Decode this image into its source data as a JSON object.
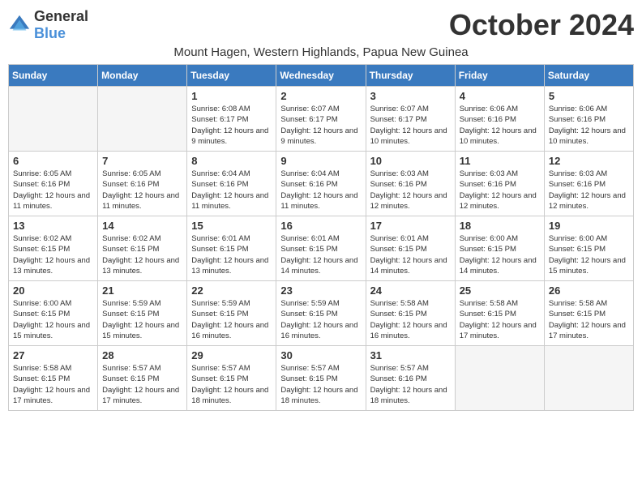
{
  "logo": {
    "general": "General",
    "blue": "Blue"
  },
  "header": {
    "month": "October 2024",
    "location": "Mount Hagen, Western Highlands, Papua New Guinea"
  },
  "weekdays": [
    "Sunday",
    "Monday",
    "Tuesday",
    "Wednesday",
    "Thursday",
    "Friday",
    "Saturday"
  ],
  "weeks": [
    [
      {
        "day": "",
        "info": ""
      },
      {
        "day": "",
        "info": ""
      },
      {
        "day": "1",
        "info": "Sunrise: 6:08 AM\nSunset: 6:17 PM\nDaylight: 12 hours and 9 minutes."
      },
      {
        "day": "2",
        "info": "Sunrise: 6:07 AM\nSunset: 6:17 PM\nDaylight: 12 hours and 9 minutes."
      },
      {
        "day": "3",
        "info": "Sunrise: 6:07 AM\nSunset: 6:17 PM\nDaylight: 12 hours and 10 minutes."
      },
      {
        "day": "4",
        "info": "Sunrise: 6:06 AM\nSunset: 6:16 PM\nDaylight: 12 hours and 10 minutes."
      },
      {
        "day": "5",
        "info": "Sunrise: 6:06 AM\nSunset: 6:16 PM\nDaylight: 12 hours and 10 minutes."
      }
    ],
    [
      {
        "day": "6",
        "info": "Sunrise: 6:05 AM\nSunset: 6:16 PM\nDaylight: 12 hours and 11 minutes."
      },
      {
        "day": "7",
        "info": "Sunrise: 6:05 AM\nSunset: 6:16 PM\nDaylight: 12 hours and 11 minutes."
      },
      {
        "day": "8",
        "info": "Sunrise: 6:04 AM\nSunset: 6:16 PM\nDaylight: 12 hours and 11 minutes."
      },
      {
        "day": "9",
        "info": "Sunrise: 6:04 AM\nSunset: 6:16 PM\nDaylight: 12 hours and 11 minutes."
      },
      {
        "day": "10",
        "info": "Sunrise: 6:03 AM\nSunset: 6:16 PM\nDaylight: 12 hours and 12 minutes."
      },
      {
        "day": "11",
        "info": "Sunrise: 6:03 AM\nSunset: 6:16 PM\nDaylight: 12 hours and 12 minutes."
      },
      {
        "day": "12",
        "info": "Sunrise: 6:03 AM\nSunset: 6:16 PM\nDaylight: 12 hours and 12 minutes."
      }
    ],
    [
      {
        "day": "13",
        "info": "Sunrise: 6:02 AM\nSunset: 6:15 PM\nDaylight: 12 hours and 13 minutes."
      },
      {
        "day": "14",
        "info": "Sunrise: 6:02 AM\nSunset: 6:15 PM\nDaylight: 12 hours and 13 minutes."
      },
      {
        "day": "15",
        "info": "Sunrise: 6:01 AM\nSunset: 6:15 PM\nDaylight: 12 hours and 13 minutes."
      },
      {
        "day": "16",
        "info": "Sunrise: 6:01 AM\nSunset: 6:15 PM\nDaylight: 12 hours and 14 minutes."
      },
      {
        "day": "17",
        "info": "Sunrise: 6:01 AM\nSunset: 6:15 PM\nDaylight: 12 hours and 14 minutes."
      },
      {
        "day": "18",
        "info": "Sunrise: 6:00 AM\nSunset: 6:15 PM\nDaylight: 12 hours and 14 minutes."
      },
      {
        "day": "19",
        "info": "Sunrise: 6:00 AM\nSunset: 6:15 PM\nDaylight: 12 hours and 15 minutes."
      }
    ],
    [
      {
        "day": "20",
        "info": "Sunrise: 6:00 AM\nSunset: 6:15 PM\nDaylight: 12 hours and 15 minutes."
      },
      {
        "day": "21",
        "info": "Sunrise: 5:59 AM\nSunset: 6:15 PM\nDaylight: 12 hours and 15 minutes."
      },
      {
        "day": "22",
        "info": "Sunrise: 5:59 AM\nSunset: 6:15 PM\nDaylight: 12 hours and 16 minutes."
      },
      {
        "day": "23",
        "info": "Sunrise: 5:59 AM\nSunset: 6:15 PM\nDaylight: 12 hours and 16 minutes."
      },
      {
        "day": "24",
        "info": "Sunrise: 5:58 AM\nSunset: 6:15 PM\nDaylight: 12 hours and 16 minutes."
      },
      {
        "day": "25",
        "info": "Sunrise: 5:58 AM\nSunset: 6:15 PM\nDaylight: 12 hours and 17 minutes."
      },
      {
        "day": "26",
        "info": "Sunrise: 5:58 AM\nSunset: 6:15 PM\nDaylight: 12 hours and 17 minutes."
      }
    ],
    [
      {
        "day": "27",
        "info": "Sunrise: 5:58 AM\nSunset: 6:15 PM\nDaylight: 12 hours and 17 minutes."
      },
      {
        "day": "28",
        "info": "Sunrise: 5:57 AM\nSunset: 6:15 PM\nDaylight: 12 hours and 17 minutes."
      },
      {
        "day": "29",
        "info": "Sunrise: 5:57 AM\nSunset: 6:15 PM\nDaylight: 12 hours and 18 minutes."
      },
      {
        "day": "30",
        "info": "Sunrise: 5:57 AM\nSunset: 6:15 PM\nDaylight: 12 hours and 18 minutes."
      },
      {
        "day": "31",
        "info": "Sunrise: 5:57 AM\nSunset: 6:16 PM\nDaylight: 12 hours and 18 minutes."
      },
      {
        "day": "",
        "info": ""
      },
      {
        "day": "",
        "info": ""
      }
    ]
  ]
}
